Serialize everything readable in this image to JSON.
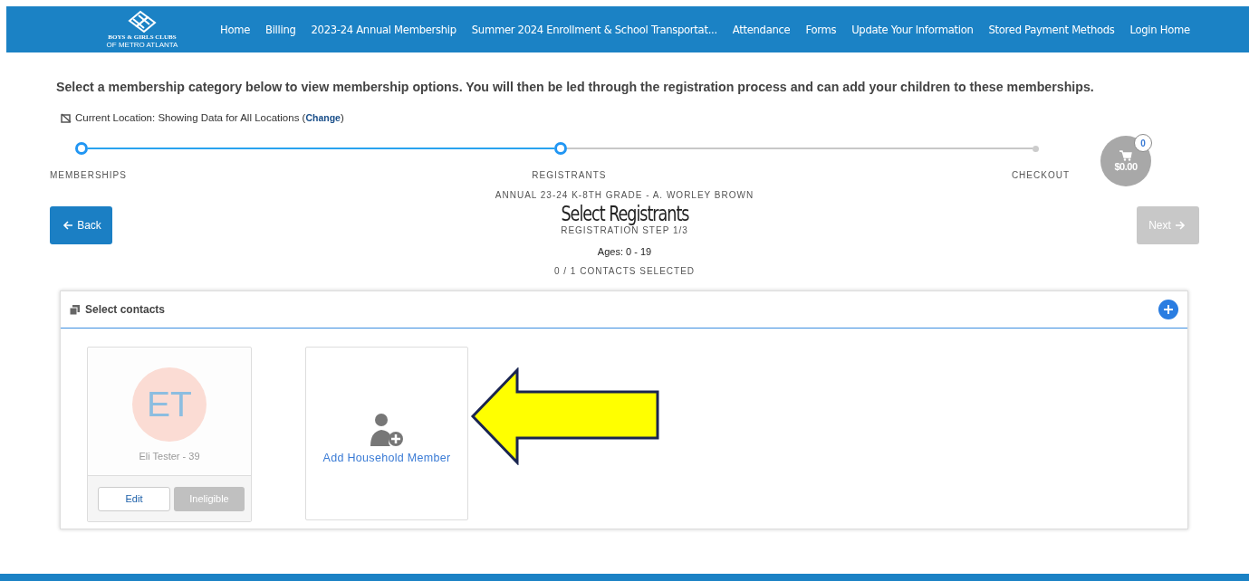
{
  "logo": {
    "line_1": "BOYS & GIRLS CLUBS",
    "line_2": "OF METRO ATLANTA"
  },
  "nav": [
    "Home",
    "Billing",
    "2023-24 Annual Membership",
    "Summer 2024 Enrollment & School Transportat...",
    "Attendance",
    "Forms",
    "Update Your Information",
    "Stored Payment Methods",
    "Login Home"
  ],
  "intro": "Select a membership category below to view membership options. You will then be led through the registration process and can add your children to these memberships.",
  "location": {
    "text": "Current Location: Showing Data for All Locations",
    "open": "(",
    "link": "Change",
    "close": ")"
  },
  "steps": [
    {
      "label": "MEMBERSHIPS",
      "reached": true
    },
    {
      "label": "REGISTRANTS",
      "reached": true
    },
    {
      "label": "CHECKOUT",
      "reached": false
    }
  ],
  "cart": {
    "count": "0",
    "total": "$0.00"
  },
  "back_button": "Back",
  "next_button": {
    "label": "Next",
    "disabled": true
  },
  "program": "ANNUAL 23-24 K-8TH GRADE - A. WORLEY BROWN",
  "title": "Select Registrants",
  "step_text": "REGISTRATION STEP 1/3",
  "ages": "Ages: 0 - 19",
  "selected_count": "0 / 1 CONTACTS SELECTED",
  "panel": {
    "title": "Select contacts"
  },
  "contacts": [
    {
      "initials": "ET",
      "name": "Eli Tester - 39",
      "edit": "Edit",
      "status": {
        "label": "Ineligible",
        "disabled": true
      }
    }
  ],
  "add_member": "Add Household Member"
}
